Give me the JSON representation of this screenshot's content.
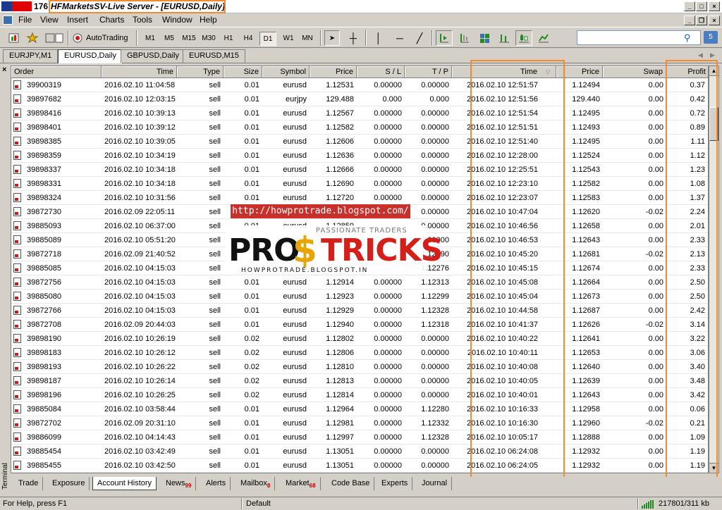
{
  "window": {
    "title_num": "176",
    "title": "HFMarketsSV-Live Server - [EURUSD,Daily]"
  },
  "menu": [
    "File",
    "View",
    "Insert",
    "Charts",
    "Tools",
    "Window",
    "Help"
  ],
  "toolbar": {
    "autotrading": "AutoTrading",
    "timeframes": [
      "M1",
      "M5",
      "M15",
      "M30",
      "H1",
      "H4",
      "D1",
      "W1",
      "MN"
    ],
    "active_timeframe": "D1",
    "chat_count": "5"
  },
  "chart_tabs": [
    "EURJPY,M1",
    "EURUSD,Daily",
    "GBPUSD,Daily",
    "EURUSD,M15"
  ],
  "active_chart_tab": "EURUSD,Daily",
  "columns": [
    "Order",
    "Time",
    "Type",
    "Size",
    "Symbol",
    "Price",
    "S / L",
    "T / P",
    "Time",
    "Price",
    "Swap",
    "Profit"
  ],
  "rows": [
    [
      "39900319",
      "2016.02.10 11:04:58",
      "sell",
      "0.01",
      "eurusd",
      "1.12531",
      "0.00000",
      "0.00000",
      "2016.02.10 12:51:57",
      "1.12494",
      "0.00",
      "0.37"
    ],
    [
      "39897682",
      "2016.02.10 12:03:15",
      "sell",
      "0.01",
      "eurjpy",
      "129.488",
      "0.000",
      "0.000",
      "2016.02.10 12:51:56",
      "129.440",
      "0.00",
      "0.42"
    ],
    [
      "39898416",
      "2016.02.10 10:39:13",
      "sell",
      "0.01",
      "eurusd",
      "1.12567",
      "0.00000",
      "0.00000",
      "2016.02.10 12:51:54",
      "1.12495",
      "0.00",
      "0.72"
    ],
    [
      "39898401",
      "2016.02.10 10:39:12",
      "sell",
      "0.01",
      "eurusd",
      "1.12582",
      "0.00000",
      "0.00000",
      "2016.02.10 12:51:51",
      "1.12493",
      "0.00",
      "0.89"
    ],
    [
      "39898385",
      "2016.02.10 10:39:05",
      "sell",
      "0.01",
      "eurusd",
      "1.12606",
      "0.00000",
      "0.00000",
      "2016.02.10 12:51:40",
      "1.12495",
      "0.00",
      "1.11"
    ],
    [
      "39898359",
      "2016.02.10 10:34:19",
      "sell",
      "0.01",
      "eurusd",
      "1.12636",
      "0.00000",
      "0.00000",
      "2016.02.10 12:28:00",
      "1.12524",
      "0.00",
      "1.12"
    ],
    [
      "39898337",
      "2016.02.10 10:34:18",
      "sell",
      "0.01",
      "eurusd",
      "1.12666",
      "0.00000",
      "0.00000",
      "2016.02.10 12:25:51",
      "1.12543",
      "0.00",
      "1.23"
    ],
    [
      "39898331",
      "2016.02.10 10:34:18",
      "sell",
      "0.01",
      "eurusd",
      "1.12690",
      "0.00000",
      "0.00000",
      "2016.02.10 12:23:10",
      "1.12582",
      "0.00",
      "1.08"
    ],
    [
      "39898324",
      "2016.02.10 10:31:56",
      "sell",
      "0.01",
      "eurusd",
      "1.12720",
      "0.00000",
      "0.00000",
      "2016.02.10 12:23:07",
      "1.12583",
      "0.00",
      "1.37"
    ],
    [
      "39872730",
      "2016.02.09 22:05:11",
      "sell",
      "0.01",
      "eurusd",
      "",
      "",
      "0.00000",
      "2016.02.10 10:47:04",
      "1.12620",
      "-0.02",
      "2.24"
    ],
    [
      "39885093",
      "2016.02.10 06:37:00",
      "sell",
      "0.01",
      "eurusd",
      "1.12859",
      "",
      "0.00000",
      "2016.02.10 10:46:56",
      "1.12658",
      "0.00",
      "2.01"
    ],
    [
      "39885089",
      "2016.02.10 05:51:20",
      "sell",
      "",
      "",
      "",
      "",
      "0.00000",
      "2016.02.10 10:46:53",
      "1.12643",
      "0.00",
      "2.33"
    ],
    [
      "39872718",
      "2016.02.09 21:40:52",
      "sell",
      "",
      "",
      "",
      "",
      "1.12290",
      "2016.02.10 10:45:20",
      "1.12681",
      "-0.02",
      "2.13"
    ],
    [
      "39885085",
      "2016.02.10 04:15:03",
      "sell",
      "",
      "",
      "",
      "",
      "1.12276",
      "2016.02.10 10:45:15",
      "1.12674",
      "0.00",
      "2.33"
    ],
    [
      "39872756",
      "2016.02.10 04:15:03",
      "sell",
      "0.01",
      "eurusd",
      "1.12914",
      "0.00000",
      "1.12313",
      "2016.02.10 10:45:08",
      "1.12664",
      "0.00",
      "2.50"
    ],
    [
      "39885080",
      "2016.02.10 04:15:03",
      "sell",
      "0.01",
      "eurusd",
      "1.12923",
      "0.00000",
      "1.12299",
      "2016.02.10 10:45:04",
      "1.12673",
      "0.00",
      "2.50"
    ],
    [
      "39872766",
      "2016.02.10 04:15:03",
      "sell",
      "0.01",
      "eurusd",
      "1.12929",
      "0.00000",
      "1.12328",
      "2016.02.10 10:44:58",
      "1.12687",
      "0.00",
      "2.42"
    ],
    [
      "39872708",
      "2016.02.09 20:44:03",
      "sell",
      "0.01",
      "eurusd",
      "1.12940",
      "0.00000",
      "1.12318",
      "2016.02.10 10:41:37",
      "1.12626",
      "-0.02",
      "3.14"
    ],
    [
      "39898190",
      "2016.02.10 10:26:19",
      "sell",
      "0.02",
      "eurusd",
      "1.12802",
      "0.00000",
      "0.00000",
      "2016.02.10 10:40:22",
      "1.12641",
      "0.00",
      "3.22"
    ],
    [
      "39898183",
      "2016.02.10 10:26:12",
      "sell",
      "0.02",
      "eurusd",
      "1.12806",
      "0.00000",
      "0.00000",
      "2016.02.10 10:40:11",
      "1.12653",
      "0.00",
      "3.06"
    ],
    [
      "39898193",
      "2016.02.10 10:26:22",
      "sell",
      "0.02",
      "eurusd",
      "1.12810",
      "0.00000",
      "0.00000",
      "2016.02.10 10:40:08",
      "1.12640",
      "0.00",
      "3.40"
    ],
    [
      "39898187",
      "2016.02.10 10:26:14",
      "sell",
      "0.02",
      "eurusd",
      "1.12813",
      "0.00000",
      "0.00000",
      "2016.02.10 10:40:05",
      "1.12639",
      "0.00",
      "3.48"
    ],
    [
      "39898196",
      "2016.02.10 10:26:25",
      "sell",
      "0.02",
      "eurusd",
      "1.12814",
      "0.00000",
      "0.00000",
      "2016.02.10 10:40:01",
      "1.12643",
      "0.00",
      "3.42"
    ],
    [
      "39885084",
      "2016.02.10 03:58:44",
      "sell",
      "0.01",
      "eurusd",
      "1.12964",
      "0.00000",
      "1.12280",
      "2016.02.10 10:16:33",
      "1.12958",
      "0.00",
      "0.06"
    ],
    [
      "39872702",
      "2016.02.09 20:31:10",
      "sell",
      "0.01",
      "eurusd",
      "1.12981",
      "0.00000",
      "1.12332",
      "2016.02.10 10:16:30",
      "1.12960",
      "-0.02",
      "0.21"
    ],
    [
      "39886099",
      "2016.02.10 04:14:43",
      "sell",
      "0.01",
      "eurusd",
      "1.12997",
      "0.00000",
      "1.12328",
      "2016.02.10 10:05:17",
      "1.12888",
      "0.00",
      "1.09"
    ],
    [
      "39885454",
      "2016.02.10 03:42:49",
      "sell",
      "0.01",
      "eurusd",
      "1.13051",
      "0.00000",
      "0.00000",
      "2016.02.10 06:24:08",
      "1.12932",
      "0.00",
      "1.19"
    ],
    [
      "39885455",
      "2016.02.10 03:42:50",
      "sell",
      "0.01",
      "eurusd",
      "1.13051",
      "0.00000",
      "0.00000",
      "2016.02.10 06:24:05",
      "1.12932",
      "0.00",
      "1.19"
    ]
  ],
  "watermark": {
    "url": "http://howprotrade.blogspot.com/",
    "tagline": "PASSIONATE TRADERS",
    "pro": "PRO",
    "dollar": "$",
    "tricks": "TRICKS",
    "sub": "HOWPROTRADE.BLOGSPOT.IN"
  },
  "bottom_tabs": [
    {
      "label": "Trade",
      "badge": ""
    },
    {
      "label": "Exposure",
      "badge": ""
    },
    {
      "label": "Account History",
      "badge": ""
    },
    {
      "label": "News",
      "badge": "99"
    },
    {
      "label": "Alerts",
      "badge": ""
    },
    {
      "label": "Mailbox",
      "badge": "8"
    },
    {
      "label": "Market",
      "badge": "68"
    },
    {
      "label": "Code Base",
      "badge": ""
    },
    {
      "label": "Experts",
      "badge": ""
    },
    {
      "label": "Journal",
      "badge": ""
    }
  ],
  "active_bottom_tab": "Account History",
  "terminal_label": "Terminal",
  "status": {
    "help": "For Help, press F1",
    "profile": "Default",
    "traffic": "217801/311 kb"
  },
  "colors": {
    "highlight": "#f28a30",
    "accent_red": "#d01818"
  }
}
